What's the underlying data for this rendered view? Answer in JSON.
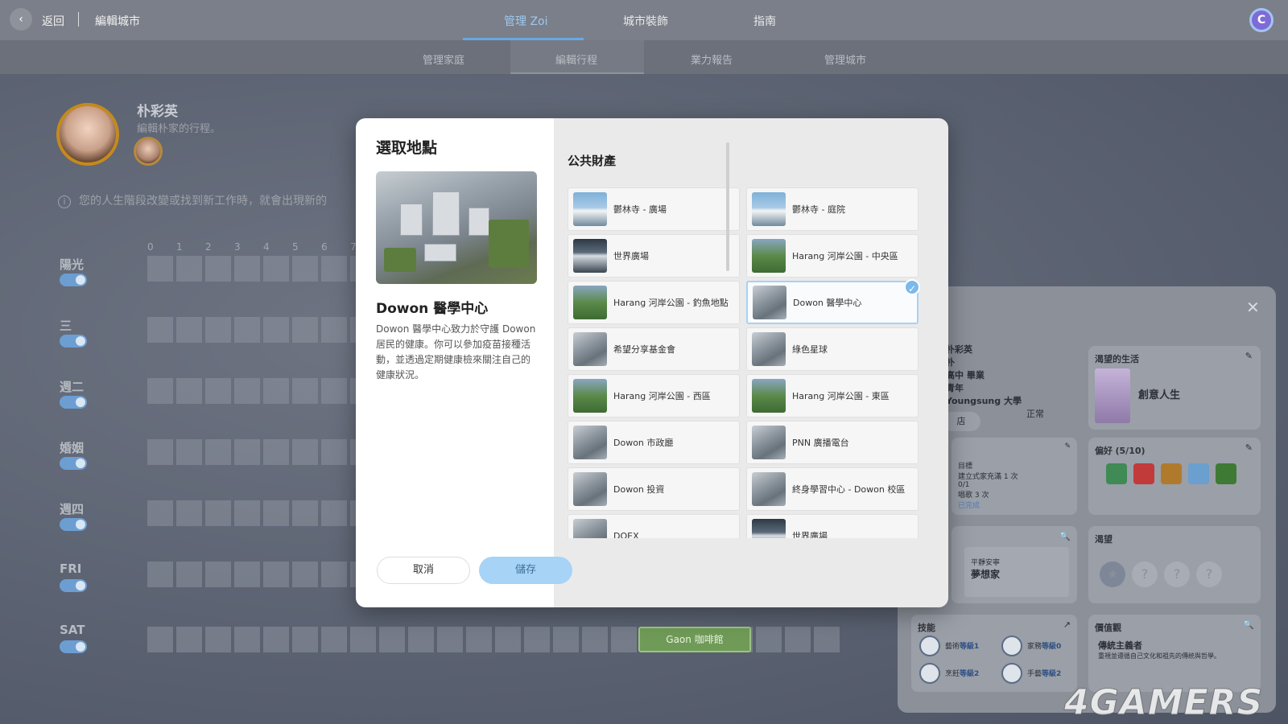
{
  "topbar": {
    "back_label": "返回",
    "breadcrumb": "編輯城市",
    "tabs": [
      "管理 Zoi",
      "城市裝飾",
      "指南"
    ],
    "brand_icon_letter": "C"
  },
  "subbar": {
    "tabs": [
      "管理家庭",
      "編輯行程",
      "業力報告",
      "管理城市"
    ]
  },
  "background": {
    "sim_name": "朴彩英",
    "sim_sub": "編輯朴家的行程。",
    "info_text": "您的人生階段改變或找到新工作時，就會出現新的",
    "hours": [
      "0",
      "1",
      "2",
      "3",
      "4",
      "5",
      "6",
      "7"
    ],
    "days": [
      "陽光",
      "三",
      "週二",
      "婚姻",
      "週四",
      "FRI",
      "SAT"
    ],
    "cafe_label": "Gaon 咖啡館",
    "side_panel": {
      "profile_lines": [
        "朴彩英",
        "朴",
        "高中 畢業",
        "青年"
      ],
      "university": "Youngsung 大學",
      "mood": "正常",
      "store_label": "店",
      "desired_life_title": "渴望的生活",
      "desired_life_value": "創意人生",
      "preferences_title": "偏好",
      "preferences_count": "(5/10)",
      "goal_lines": [
        "目標",
        "建立式家充滿 1 次",
        "0/1",
        "唱歌 3 次",
        "已完成"
      ],
      "dream_sub": "平靜安寧",
      "dream_title": "夢想家",
      "wishes_title": "渴望",
      "skills_title": "技能",
      "skills": [
        {
          "name": "藝術",
          "level": "等級1"
        },
        {
          "name": "家務",
          "level": "等級0"
        },
        {
          "name": "烹飪",
          "level": "等級2"
        },
        {
          "name": "手藝",
          "level": "等級2"
        }
      ],
      "values_title": "價值觀",
      "values_value": "傳統主義者",
      "values_desc": "重視並遵循自己文化和祖先的傳統與哲學。"
    }
  },
  "modal": {
    "title": "選取地點",
    "place_name": "Dowon 醫學中心",
    "place_desc": "Dowon 醫學中心致力於守護 Dowon 居民的健康。你可以參加疫苗接種活動，並透過定期健康檢來關注自己的健康狀況。",
    "section_title": "公共財產",
    "items": [
      {
        "label": "鬱林寺 - 廣場",
        "thumb": "temple"
      },
      {
        "label": "鬱林寺 - 庭院",
        "thumb": "temple"
      },
      {
        "label": "世界廣場",
        "thumb": "plaza"
      },
      {
        "label": "Harang 河岸公園 - 中央區",
        "thumb": "park"
      },
      {
        "label": "Harang 河岸公園 - 釣魚地點",
        "thumb": "park"
      },
      {
        "label": "Dowon 醫學中心",
        "thumb": "generic",
        "selected": true
      },
      {
        "label": "希望分享基金會",
        "thumb": "generic"
      },
      {
        "label": "綠色星球",
        "thumb": "generic"
      },
      {
        "label": "Harang 河岸公園 - 西區",
        "thumb": "park"
      },
      {
        "label": "Harang 河岸公園 - 東區",
        "thumb": "park"
      },
      {
        "label": "Dowon 市政廳",
        "thumb": "generic"
      },
      {
        "label": "PNN 廣播電台",
        "thumb": "generic"
      },
      {
        "label": "Dowon 投資",
        "thumb": "generic"
      },
      {
        "label": "終身學習中心 - Dowon 校區",
        "thumb": "generic"
      },
      {
        "label": "DOEX",
        "thumb": "generic"
      },
      {
        "label": "世界廣場",
        "thumb": "plaza"
      }
    ],
    "cancel_label": "取消",
    "save_label": "儲存"
  },
  "watermark": "4GAMERS",
  "colors": {
    "accent": "#7cb9ea",
    "save_button": "#a7d3f6",
    "active_tab": "#9fc8ee",
    "cafe_block": "#6f9a57"
  }
}
